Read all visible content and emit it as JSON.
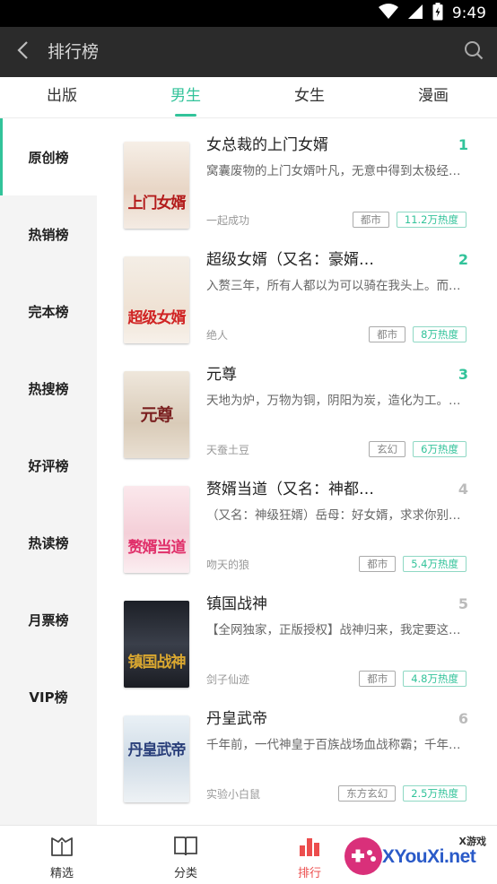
{
  "status": {
    "time": "9:49"
  },
  "topbar": {
    "title": "排行榜"
  },
  "tabs": [
    {
      "label": "出版"
    },
    {
      "label": "男生"
    },
    {
      "label": "女生"
    },
    {
      "label": "漫画"
    }
  ],
  "active_tab": "男生",
  "sidebar": {
    "items": [
      {
        "label": "原创榜"
      },
      {
        "label": "热销榜"
      },
      {
        "label": "完本榜"
      },
      {
        "label": "热搜榜"
      },
      {
        "label": "好评榜"
      },
      {
        "label": "热读榜"
      },
      {
        "label": "月票榜"
      },
      {
        "label": "VIP榜"
      }
    ],
    "active": "原创榜"
  },
  "books": [
    {
      "rank": "1",
      "title": "女总裁的上门女婿",
      "desc": "窝囊废物的上门女婿叶凡，无意中得到太极经…",
      "author": "一起成功",
      "genre": "都市",
      "heat": "11.2万热度",
      "cover_text": "上门女婿",
      "cover_color": "#b31b1b"
    },
    {
      "rank": "2",
      "title": "超级女婿（又名：豪婿…",
      "desc": "入赘三年，所有人都以为可以骑在我头上。而…",
      "author": "绝人",
      "genre": "都市",
      "heat": "8万热度",
      "cover_text": "超级女婿",
      "cover_color": "#d02424"
    },
    {
      "rank": "3",
      "title": "元尊",
      "desc": "天地为炉，万物为铜，阴阳为炭，造化为工。…",
      "author": "天蚕土豆",
      "genre": "玄幻",
      "heat": "6万热度",
      "cover_text": "元尊",
      "cover_color": "#7a1f1f"
    },
    {
      "rank": "4",
      "title": "赘婿当道（又名：神都…",
      "desc": "（又名：神级狂婿）岳母：好女婿，求求你别…",
      "author": "吻天的狼",
      "genre": "都市",
      "heat": "5.4万热度",
      "cover_text": "赘婿当道",
      "cover_color": "#e0306a"
    },
    {
      "rank": "5",
      "title": "镇国战神",
      "desc": "【全网独家，正版授权】战神归来，我定要这…",
      "author": "剑子仙迹",
      "genre": "都市",
      "heat": "4.8万热度",
      "cover_text": "镇国战神",
      "cover_color": "#d9a730"
    },
    {
      "rank": "6",
      "title": "丹皇武帝",
      "desc": "千年前，一代神皇于百族战场血战称霸；千年…",
      "author": "实验小白鼠",
      "genre": "东方玄幻",
      "heat": "2.5万热度",
      "cover_text": "丹皇武帝",
      "cover_color": "#2a3f7a"
    }
  ],
  "bottomnav": [
    {
      "label": "精选",
      "icon": "book-stack-icon"
    },
    {
      "label": "分类",
      "icon": "open-book-icon"
    },
    {
      "label": "排行",
      "icon": "bar-chart-icon"
    },
    {
      "label": "",
      "icon": ""
    }
  ],
  "active_nav": "排行",
  "watermark": {
    "small": "X游戏",
    "big": "XYouXi.net"
  },
  "colors": {
    "accent": "#32c39a",
    "nav_active": "#ec4d4d",
    "topbar": "#2b2b2b"
  }
}
